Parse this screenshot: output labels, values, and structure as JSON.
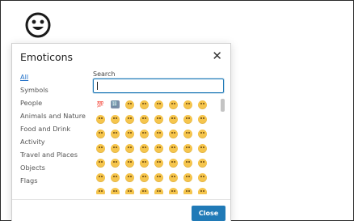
{
  "toolbar": {
    "emoticons_icon": "smiley-face-icon"
  },
  "dialog": {
    "title": "Emoticons",
    "close_icon": "close-icon",
    "categories": [
      {
        "label": "All",
        "active": true
      },
      {
        "label": "Symbols"
      },
      {
        "label": "People"
      },
      {
        "label": "Animals and Nature"
      },
      {
        "label": "Food and Drink"
      },
      {
        "label": "Activity"
      },
      {
        "label": "Travel and Places"
      },
      {
        "label": "Objects"
      },
      {
        "label": "Flags"
      }
    ],
    "search": {
      "label": "Search",
      "value": ""
    },
    "emoji_rows": [
      [
        "hundred-points-icon",
        "input-numbers-icon",
        "grinning-face-icon",
        "smiling-face-icon",
        "grinning-squinting-face-icon",
        "grinning-face-sweat-icon",
        "rolling-laughing-face-icon",
        "joy-face-icon"
      ],
      [
        "slightly-smiling-face-icon",
        "upside-down-face-icon",
        "winking-face-icon",
        "smiling-eyes-face-icon",
        "halo-face-icon",
        "heart-eyes-face-icon",
        "star-struck-face-icon",
        "kissing-face-icon"
      ],
      [
        "neutral-face-icon",
        "smiling-face-2-icon",
        "blush-face-icon",
        "heart-face-icon",
        "kissing-face-2-icon",
        "tongue-face-icon",
        "wink-tongue-face-icon",
        "zany-face-icon"
      ],
      [
        "tongue-closed-eyes-face-icon",
        "money-face-icon",
        "hugging-face-icon",
        "hand-over-mouth-face-icon",
        "shushing-face-icon",
        "thinking-face-icon",
        "zipper-face-icon",
        "raised-eyebrow-face-icon"
      ],
      [
        "sunglasses-face-icon",
        "nerd-face-icon",
        "monocle-face-icon",
        "confused-face-icon",
        "worried-face-icon",
        "frowning-face-icon",
        "open-mouth-face-icon",
        "hushed-face-icon"
      ],
      [
        "astonished-face-icon",
        "flushed-face-icon",
        "pleading-face-icon",
        "frowning-open-face-icon",
        "anguished-face-icon",
        "fearful-face-icon",
        "anxious-face-icon",
        "sad-relieved-face-icon"
      ],
      [
        "crying-face-icon",
        "loud-crying-face-icon",
        "screaming-face-icon",
        "confounded-face-icon",
        "persevering-face-icon",
        "disappointed-face-icon",
        "downcast-face-icon",
        "weary-face-icon"
      ]
    ],
    "close_button": "Close"
  }
}
